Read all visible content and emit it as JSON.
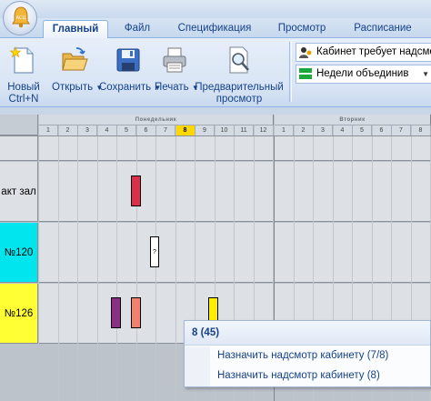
{
  "tabs": [
    {
      "label": "Главный",
      "active": true
    },
    {
      "label": "Файл",
      "active": false
    },
    {
      "label": "Спецификация",
      "active": false
    },
    {
      "label": "Просмотр",
      "active": false
    },
    {
      "label": "Расписание",
      "active": false
    }
  ],
  "ribbon": {
    "new_label": "Новый",
    "new_shortcut": "Ctrl+N",
    "open_label": "Открыть",
    "save_label": "Сохранить",
    "print_label": "Печать",
    "preview_label_1": "Предварительный",
    "preview_label_2": "просмотр",
    "combo1": "Кабинет требует надсмотр",
    "combo2": "Недели объединив"
  },
  "schedule": {
    "days": [
      "Понедельник",
      "Вторник"
    ],
    "lessons_day1": [
      "1",
      "2",
      "3",
      "4",
      "5",
      "6",
      "7",
      "8",
      "9",
      "10",
      "11",
      "12"
    ],
    "lessons_day2": [
      "1",
      "2",
      "3",
      "4",
      "5",
      "6",
      "7",
      "8"
    ],
    "selected_lesson": "8",
    "rows": [
      {
        "label": "",
        "color": "#dde1e6"
      },
      {
        "label": "акт зал",
        "color": "#dde1e6"
      },
      {
        "label": "№120",
        "color": "#00e5ee"
      },
      {
        "label": "№126",
        "color": "#ffff33"
      }
    ],
    "unknown_mark": "?"
  },
  "popup": {
    "title": "8 (45)",
    "item1": "Назначить надсмотр кабинету (7/8)",
    "item2": "Назначить надсмотр кабинету (8)"
  },
  "colors": {
    "accent": "#15428b",
    "red_block": "#d9314b",
    "purple_block": "#8b2f86",
    "salmon_block": "#f08070",
    "yellow_block": "#ffee00"
  }
}
